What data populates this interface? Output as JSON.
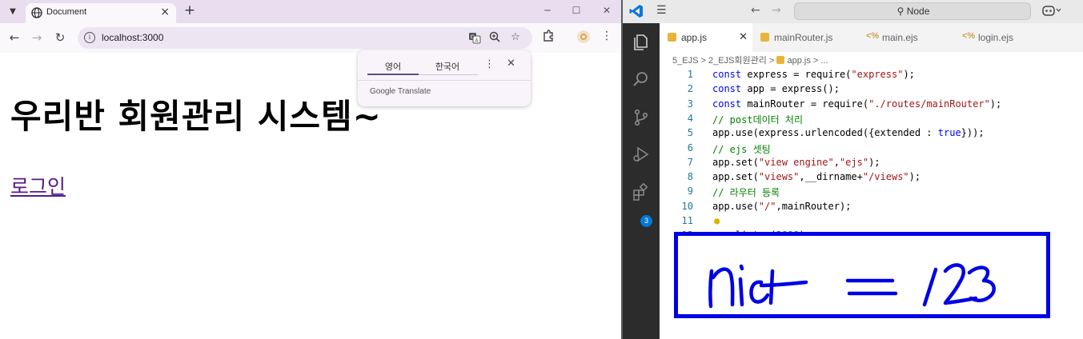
{
  "browser": {
    "tab_title": "Document",
    "url": "localhost:3000",
    "new_tab_glyph": "+",
    "page": {
      "heading": "우리반 회원관리 시스템~",
      "login_link": "로그인"
    },
    "translate_popup": {
      "lang_source": "영어",
      "lang_target": "한국어",
      "brand": "Google Translate"
    }
  },
  "vscode": {
    "command_center": "Node",
    "tabs": [
      {
        "label": "app.js",
        "icon": "js-file-icon",
        "active": true
      },
      {
        "label": "mainRouter.js",
        "icon": "js-file-icon",
        "active": false
      },
      {
        "label": "main.ejs",
        "icon": "ejs-file-icon",
        "active": false
      },
      {
        "label": "login.ejs",
        "icon": "ejs-file-icon",
        "active": false
      }
    ],
    "breadcrumb": [
      "5_EJS",
      "2_EJS회원관리",
      "app.js",
      "..."
    ],
    "extensions_badge": "3",
    "code_lines": [
      {
        "n": "1",
        "text": "const express = require(\"express\");"
      },
      {
        "n": "2",
        "text": "const app = express();"
      },
      {
        "n": "3",
        "text": "const mainRouter = require(\"./routes/mainRouter\");"
      },
      {
        "n": "4",
        "text": "// post데이터 처리"
      },
      {
        "n": "5",
        "text": "app.use(express.urlencoded({extended : true}));"
      },
      {
        "n": "6",
        "text": "// ejs 셋팅"
      },
      {
        "n": "7",
        "text": "app.set(\"view engine\",\"ejs\");"
      },
      {
        "n": "8",
        "text": "app.set(\"views\",__dirname+\"/views\");"
      },
      {
        "n": "9",
        "text": "// 라우터 등록"
      },
      {
        "n": "10",
        "text": "app.use(\"/\",mainRouter);"
      },
      {
        "n": "11",
        "text": ""
      },
      {
        "n": "12",
        "text": "app.listen(3000);"
      }
    ]
  },
  "colors": {
    "keyword": "#0000ff",
    "string": "#a31515",
    "comment": "#008000",
    "number": "#098658",
    "annotation_box": "#0000e6",
    "visited_link": "#551a8b"
  }
}
